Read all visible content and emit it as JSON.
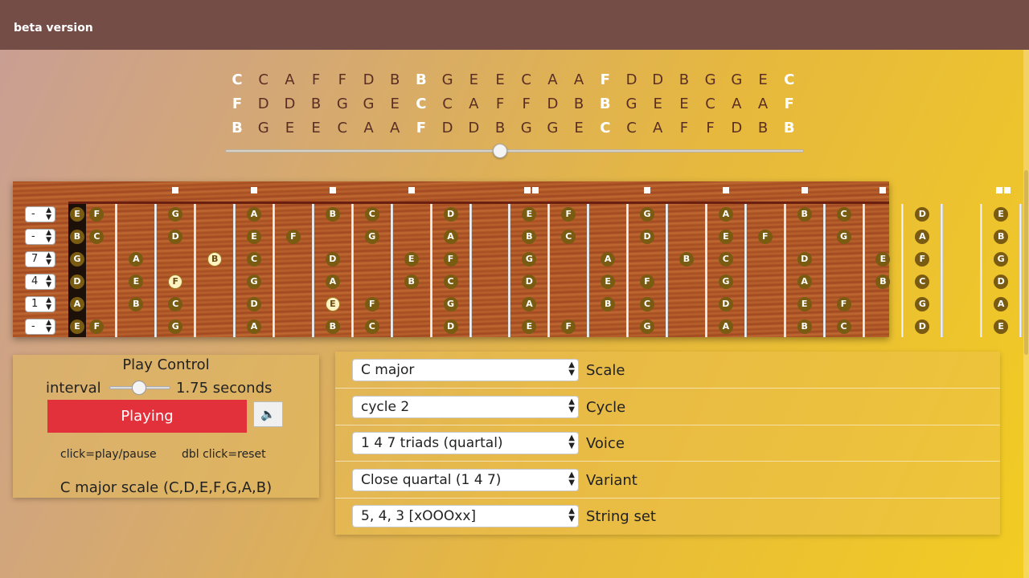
{
  "header": {
    "label": "beta version"
  },
  "cycle_rows": [
    [
      "C",
      "C",
      "A",
      "F",
      "F",
      "D",
      "B",
      "B",
      "G",
      "E",
      "E",
      "C",
      "A",
      "A",
      "F",
      "D",
      "D",
      "B",
      "G",
      "G",
      "E",
      "C"
    ],
    [
      "F",
      "D",
      "D",
      "B",
      "G",
      "G",
      "E",
      "C",
      "C",
      "A",
      "F",
      "F",
      "D",
      "B",
      "B",
      "G",
      "E",
      "E",
      "C",
      "A",
      "A",
      "F"
    ],
    [
      "B",
      "G",
      "E",
      "E",
      "C",
      "A",
      "A",
      "F",
      "D",
      "D",
      "B",
      "G",
      "G",
      "E",
      "C",
      "C",
      "A",
      "F",
      "F",
      "D",
      "B",
      "B"
    ]
  ],
  "cycle_highlight_cols": [
    0,
    7,
    14,
    21
  ],
  "cycle_slider_value": 0.475,
  "fretboard": {
    "string_selects": [
      "-",
      "-",
      "7",
      "4",
      "1",
      "-"
    ],
    "strings": [
      {
        "notes": [
          [
            0,
            "E"
          ],
          [
            1,
            "F"
          ],
          [
            3,
            "G"
          ],
          [
            5,
            "A"
          ],
          [
            7,
            "B"
          ],
          [
            8,
            "C"
          ],
          [
            10,
            "D"
          ],
          [
            12,
            "E"
          ],
          [
            13,
            "F"
          ],
          [
            15,
            "G"
          ],
          [
            17,
            "A"
          ],
          [
            19,
            "B"
          ],
          [
            20,
            "C"
          ],
          [
            22,
            "D"
          ],
          [
            24,
            "E"
          ]
        ]
      },
      {
        "notes": [
          [
            0,
            "B"
          ],
          [
            1,
            "C"
          ],
          [
            3,
            "D"
          ],
          [
            5,
            "E"
          ],
          [
            6,
            "F"
          ],
          [
            8,
            "G"
          ],
          [
            10,
            "A"
          ],
          [
            12,
            "B"
          ],
          [
            13,
            "C"
          ],
          [
            15,
            "D"
          ],
          [
            17,
            "E"
          ],
          [
            18,
            "F"
          ],
          [
            20,
            "G"
          ],
          [
            22,
            "A"
          ],
          [
            24,
            "B"
          ]
        ]
      },
      {
        "notes": [
          [
            0,
            "G"
          ],
          [
            2,
            "A"
          ],
          [
            4,
            "B"
          ],
          [
            5,
            "C"
          ],
          [
            7,
            "D"
          ],
          [
            9,
            "E"
          ],
          [
            10,
            "F"
          ],
          [
            12,
            "G"
          ],
          [
            14,
            "A"
          ],
          [
            16,
            "B"
          ],
          [
            17,
            "C"
          ],
          [
            19,
            "D"
          ],
          [
            21,
            "E"
          ],
          [
            22,
            "F"
          ],
          [
            24,
            "G"
          ]
        ]
      },
      {
        "notes": [
          [
            0,
            "D"
          ],
          [
            2,
            "E"
          ],
          [
            3,
            "F"
          ],
          [
            5,
            "G"
          ],
          [
            7,
            "A"
          ],
          [
            9,
            "B"
          ],
          [
            10,
            "C"
          ],
          [
            12,
            "D"
          ],
          [
            14,
            "E"
          ],
          [
            15,
            "F"
          ],
          [
            17,
            "G"
          ],
          [
            19,
            "A"
          ],
          [
            21,
            "B"
          ],
          [
            22,
            "C"
          ],
          [
            24,
            "D"
          ]
        ]
      },
      {
        "notes": [
          [
            0,
            "A"
          ],
          [
            2,
            "B"
          ],
          [
            3,
            "C"
          ],
          [
            5,
            "D"
          ],
          [
            7,
            "E"
          ],
          [
            8,
            "F"
          ],
          [
            10,
            "G"
          ],
          [
            12,
            "A"
          ],
          [
            14,
            "B"
          ],
          [
            15,
            "C"
          ],
          [
            17,
            "D"
          ],
          [
            19,
            "E"
          ],
          [
            20,
            "F"
          ],
          [
            22,
            "G"
          ],
          [
            24,
            "A"
          ]
        ]
      },
      {
        "notes": [
          [
            0,
            "E"
          ],
          [
            1,
            "F"
          ],
          [
            3,
            "G"
          ],
          [
            5,
            "A"
          ],
          [
            7,
            "B"
          ],
          [
            8,
            "C"
          ],
          [
            10,
            "D"
          ],
          [
            12,
            "E"
          ],
          [
            13,
            "F"
          ],
          [
            15,
            "G"
          ],
          [
            17,
            "A"
          ],
          [
            19,
            "B"
          ],
          [
            20,
            "C"
          ],
          [
            22,
            "D"
          ],
          [
            24,
            "E"
          ]
        ]
      }
    ],
    "highlighted": [
      [
        2,
        4
      ],
      [
        3,
        3
      ],
      [
        4,
        7
      ]
    ],
    "inlay_frets": [
      3,
      5,
      7,
      9,
      12,
      15,
      17,
      19,
      21,
      24
    ],
    "double_inlay_frets": [
      12,
      24
    ]
  },
  "play_control": {
    "title": "Play Control",
    "interval_label": "interval",
    "interval_value": "1.75 seconds",
    "interval_slider_value": 0.4,
    "play_button": "Playing",
    "sound_icon": "speaker-icon",
    "hint_click": "click=play/pause",
    "hint_dblclick": "dbl click=reset",
    "scale_description": "C major scale (C,D,E,F,G,A,B)"
  },
  "settings": [
    {
      "value": "C major",
      "label": "Scale"
    },
    {
      "value": "cycle 2",
      "label": "Cycle"
    },
    {
      "value": "1 4 7 triads (quartal)",
      "label": "Voice"
    },
    {
      "value": "Close quartal (1 4 7)",
      "label": "Variant"
    },
    {
      "value": "5, 4, 3 [xOOOxx]",
      "label": "String set"
    }
  ],
  "colors": {
    "topbar": "#744d47",
    "play_button": "#e3313b",
    "note_dot": "#7a5b12",
    "note_highlight": "#fff3c4",
    "cycle_text": "#5a2e23"
  }
}
